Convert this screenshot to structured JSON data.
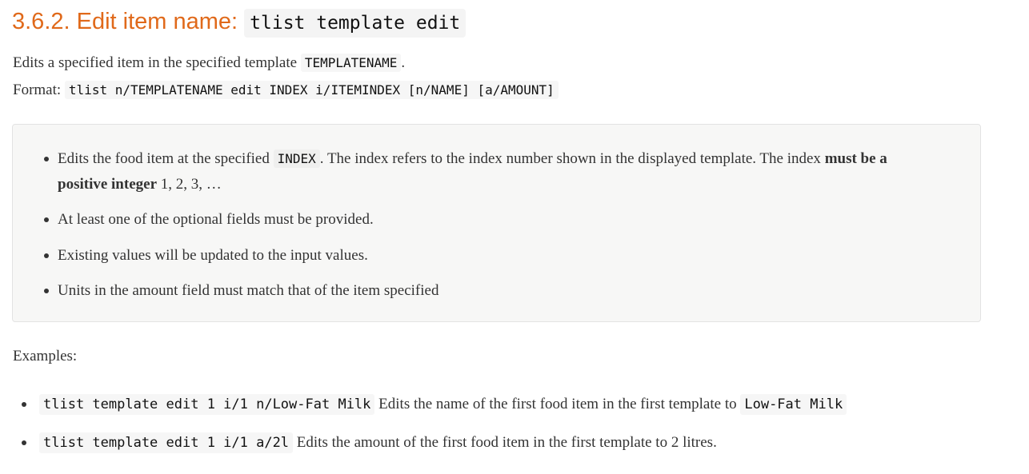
{
  "heading": {
    "number_title": "3.6.2. Edit item name:",
    "command": "tlist template edit"
  },
  "description": {
    "text": "Edits a specified item in the specified template",
    "param": "TEMPLATENAME",
    "suffix": "."
  },
  "format": {
    "label": "Format:",
    "command": "tlist n/TEMPLATENAME edit INDEX i/ITEMINDEX [n/NAME] [a/AMOUNT]"
  },
  "notes": {
    "item1": {
      "prefix": "Edits the food item at the specified",
      "param": "INDEX",
      "middle": ". The index refers to the index number shown in the displayed template. The index",
      "bold": "must be a positive integer",
      "suffix": "1, 2, 3, …"
    },
    "item2": "At least one of the optional fields must be provided.",
    "item3": "Existing values will be updated to the input values.",
    "item4": "Units in the amount field must match that of the item specified"
  },
  "examples": {
    "label": "Examples:",
    "items": [
      {
        "command": "tlist template edit 1 i/1 n/Low-Fat Milk",
        "text": "Edits the name of the first food item in the first template to",
        "value": "Low-Fat Milk"
      },
      {
        "command": "tlist template edit 1 i/1 a/2l",
        "text": "Edits the amount of the first food item in the first template to 2 litres."
      }
    ]
  }
}
